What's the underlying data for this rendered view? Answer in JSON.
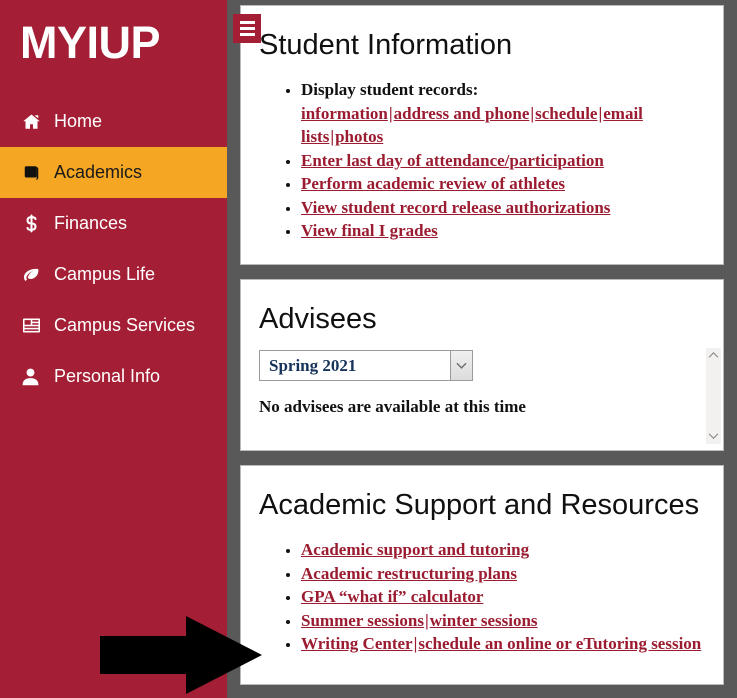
{
  "colors": {
    "sidebar_bg": "#A41F35",
    "active_bg": "#F5A623",
    "page_bg": "#595959",
    "link": "#9B1B30",
    "panel_bg": "#FFFFFF"
  },
  "sidebar": {
    "brand": "MYIUP",
    "items": [
      {
        "label": "Home",
        "icon": "home-icon",
        "active": false
      },
      {
        "label": "Academics",
        "icon": "book-icon",
        "active": true
      },
      {
        "label": "Finances",
        "icon": "dollar-sign-icon",
        "active": false
      },
      {
        "label": "Campus Life",
        "icon": "leaf-icon",
        "active": false
      },
      {
        "label": "Campus Services",
        "icon": "newspaper-icon",
        "active": false
      },
      {
        "label": "Personal Info",
        "icon": "user-icon",
        "active": false
      }
    ]
  },
  "hamburger": {
    "name": "menu-toggle",
    "icon": "hamburger-icon"
  },
  "panels": {
    "student_information": {
      "title": "Student Information",
      "display_records_label": "Display student records:",
      "record_links": [
        "information",
        "address and phone",
        "schedule",
        "email lists",
        "photos"
      ],
      "separator": "|",
      "links": [
        "Enter last day of attendance/participation",
        "Perform academic review of athletes",
        "View student record release authorizations",
        "View final I grades"
      ]
    },
    "advisees": {
      "title": "Advisees",
      "term_select": {
        "value": "Spring 2021",
        "options": [
          "Spring 2021"
        ]
      },
      "message": "No advisees are available at this time",
      "scrollbar": {
        "up": "⌃",
        "down": "⌄"
      }
    },
    "academic_support": {
      "title": "Academic Support and Resources",
      "items": [
        {
          "links": [
            "Academic support and tutoring"
          ]
        },
        {
          "links": [
            "Academic restructuring plans"
          ]
        },
        {
          "links": [
            "GPA “what if” calculator"
          ]
        },
        {
          "links": [
            "Summer sessions",
            "winter sessions"
          ]
        },
        {
          "links": [
            "Writing Center",
            "schedule an online or eTutoring session"
          ]
        }
      ],
      "separator": "|"
    }
  },
  "annotation": {
    "arrow": {
      "name": "pointer-arrow",
      "direction": "right",
      "color": "#000000",
      "points_to": "Writing Center"
    }
  }
}
